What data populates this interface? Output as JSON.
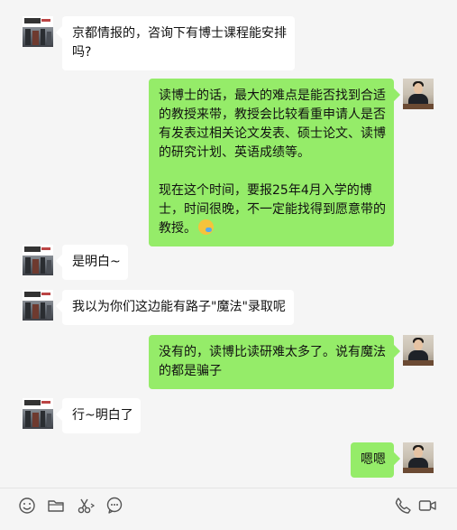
{
  "messages": [
    {
      "side": "left",
      "avatar": "school-photo-avatar",
      "lines": [
        "京都情报的，咨询下有博士课程能安排",
        "吗?"
      ]
    },
    {
      "side": "right",
      "avatar": "person-photo-avatar",
      "lines": [
        "读博士的话，最大的难点是能否找到合适",
        "的教授来带，教授会比较看重申请人是否",
        "有发表过相关论文发表、硕士论文、读博",
        "的研究计划、英语成绩等。",
        "",
        "现在这个时间，要报25年4月入学的博",
        "士，时间很晚，不一定能找得到愿意带的",
        "教授。"
      ],
      "emoji": "sweat-smile-emoji"
    },
    {
      "side": "left",
      "avatar": "school-photo-avatar",
      "lines": [
        "是明白~"
      ]
    },
    {
      "side": "left",
      "avatar": "school-photo-avatar",
      "lines": [
        "我以为你们这边能有路子\"魔法\"录取呢"
      ]
    },
    {
      "side": "right",
      "avatar": "person-photo-avatar",
      "lines": [
        "没有的，读博比读研难太多了。说有魔法",
        "的都是骗子"
      ]
    },
    {
      "side": "left",
      "avatar": "school-photo-avatar",
      "lines": [
        "行~明白了"
      ]
    },
    {
      "side": "right",
      "avatar": "person-photo-avatar",
      "lines": [
        "嗯嗯"
      ]
    }
  ],
  "toolbar": {
    "left_tools": [
      "emoji-icon",
      "folder-icon",
      "scissors-icon",
      "chat-bubble-icon"
    ],
    "right_tools": [
      "phone-icon",
      "video-icon"
    ]
  },
  "colors": {
    "background": "#f5f5f5",
    "bubble_self": "#95ec69",
    "bubble_other": "#ffffff"
  }
}
